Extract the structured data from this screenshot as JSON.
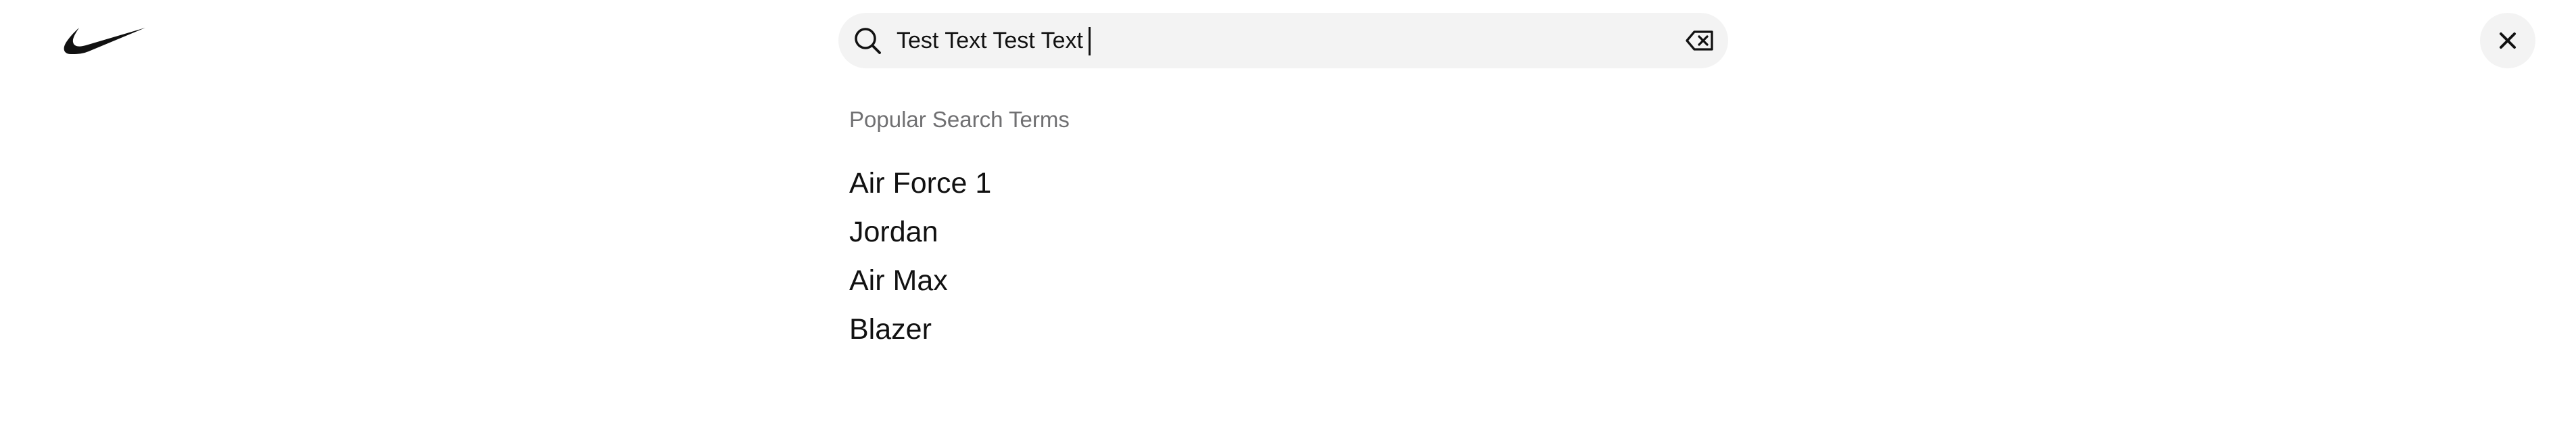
{
  "header": {
    "logo": {
      "icon": "swoosh-logo-icon",
      "color": "#111111"
    },
    "search": {
      "icon": "search-icon",
      "value": "Test Text Test Text",
      "clear_icon": "clear-text-icon"
    },
    "close": {
      "icon": "close-icon"
    }
  },
  "suggestions": {
    "heading": "Popular Search Terms",
    "items": [
      {
        "label": "Air Force 1"
      },
      {
        "label": "Jordan"
      },
      {
        "label": "Air Max"
      },
      {
        "label": "Blazer"
      }
    ]
  },
  "colors": {
    "background": "#ffffff",
    "search_bg": "#f3f3f3",
    "text": "#111111",
    "muted_text": "#707072"
  }
}
